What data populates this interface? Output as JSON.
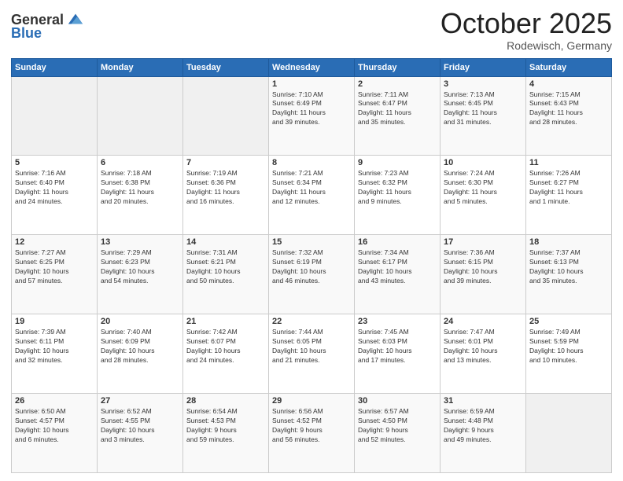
{
  "header": {
    "logo_general": "General",
    "logo_blue": "Blue",
    "month": "October 2025",
    "location": "Rodewisch, Germany"
  },
  "weekdays": [
    "Sunday",
    "Monday",
    "Tuesday",
    "Wednesday",
    "Thursday",
    "Friday",
    "Saturday"
  ],
  "weeks": [
    [
      {
        "day": "",
        "info": ""
      },
      {
        "day": "",
        "info": ""
      },
      {
        "day": "",
        "info": ""
      },
      {
        "day": "1",
        "info": "Sunrise: 7:10 AM\nSunset: 6:49 PM\nDaylight: 11 hours\nand 39 minutes."
      },
      {
        "day": "2",
        "info": "Sunrise: 7:11 AM\nSunset: 6:47 PM\nDaylight: 11 hours\nand 35 minutes."
      },
      {
        "day": "3",
        "info": "Sunrise: 7:13 AM\nSunset: 6:45 PM\nDaylight: 11 hours\nand 31 minutes."
      },
      {
        "day": "4",
        "info": "Sunrise: 7:15 AM\nSunset: 6:43 PM\nDaylight: 11 hours\nand 28 minutes."
      }
    ],
    [
      {
        "day": "5",
        "info": "Sunrise: 7:16 AM\nSunset: 6:40 PM\nDaylight: 11 hours\nand 24 minutes."
      },
      {
        "day": "6",
        "info": "Sunrise: 7:18 AM\nSunset: 6:38 PM\nDaylight: 11 hours\nand 20 minutes."
      },
      {
        "day": "7",
        "info": "Sunrise: 7:19 AM\nSunset: 6:36 PM\nDaylight: 11 hours\nand 16 minutes."
      },
      {
        "day": "8",
        "info": "Sunrise: 7:21 AM\nSunset: 6:34 PM\nDaylight: 11 hours\nand 12 minutes."
      },
      {
        "day": "9",
        "info": "Sunrise: 7:23 AM\nSunset: 6:32 PM\nDaylight: 11 hours\nand 9 minutes."
      },
      {
        "day": "10",
        "info": "Sunrise: 7:24 AM\nSunset: 6:30 PM\nDaylight: 11 hours\nand 5 minutes."
      },
      {
        "day": "11",
        "info": "Sunrise: 7:26 AM\nSunset: 6:27 PM\nDaylight: 11 hours\nand 1 minute."
      }
    ],
    [
      {
        "day": "12",
        "info": "Sunrise: 7:27 AM\nSunset: 6:25 PM\nDaylight: 10 hours\nand 57 minutes."
      },
      {
        "day": "13",
        "info": "Sunrise: 7:29 AM\nSunset: 6:23 PM\nDaylight: 10 hours\nand 54 minutes."
      },
      {
        "day": "14",
        "info": "Sunrise: 7:31 AM\nSunset: 6:21 PM\nDaylight: 10 hours\nand 50 minutes."
      },
      {
        "day": "15",
        "info": "Sunrise: 7:32 AM\nSunset: 6:19 PM\nDaylight: 10 hours\nand 46 minutes."
      },
      {
        "day": "16",
        "info": "Sunrise: 7:34 AM\nSunset: 6:17 PM\nDaylight: 10 hours\nand 43 minutes."
      },
      {
        "day": "17",
        "info": "Sunrise: 7:36 AM\nSunset: 6:15 PM\nDaylight: 10 hours\nand 39 minutes."
      },
      {
        "day": "18",
        "info": "Sunrise: 7:37 AM\nSunset: 6:13 PM\nDaylight: 10 hours\nand 35 minutes."
      }
    ],
    [
      {
        "day": "19",
        "info": "Sunrise: 7:39 AM\nSunset: 6:11 PM\nDaylight: 10 hours\nand 32 minutes."
      },
      {
        "day": "20",
        "info": "Sunrise: 7:40 AM\nSunset: 6:09 PM\nDaylight: 10 hours\nand 28 minutes."
      },
      {
        "day": "21",
        "info": "Sunrise: 7:42 AM\nSunset: 6:07 PM\nDaylight: 10 hours\nand 24 minutes."
      },
      {
        "day": "22",
        "info": "Sunrise: 7:44 AM\nSunset: 6:05 PM\nDaylight: 10 hours\nand 21 minutes."
      },
      {
        "day": "23",
        "info": "Sunrise: 7:45 AM\nSunset: 6:03 PM\nDaylight: 10 hours\nand 17 minutes."
      },
      {
        "day": "24",
        "info": "Sunrise: 7:47 AM\nSunset: 6:01 PM\nDaylight: 10 hours\nand 13 minutes."
      },
      {
        "day": "25",
        "info": "Sunrise: 7:49 AM\nSunset: 5:59 PM\nDaylight: 10 hours\nand 10 minutes."
      }
    ],
    [
      {
        "day": "26",
        "info": "Sunrise: 6:50 AM\nSunset: 4:57 PM\nDaylight: 10 hours\nand 6 minutes."
      },
      {
        "day": "27",
        "info": "Sunrise: 6:52 AM\nSunset: 4:55 PM\nDaylight: 10 hours\nand 3 minutes."
      },
      {
        "day": "28",
        "info": "Sunrise: 6:54 AM\nSunset: 4:53 PM\nDaylight: 9 hours\nand 59 minutes."
      },
      {
        "day": "29",
        "info": "Sunrise: 6:56 AM\nSunset: 4:52 PM\nDaylight: 9 hours\nand 56 minutes."
      },
      {
        "day": "30",
        "info": "Sunrise: 6:57 AM\nSunset: 4:50 PM\nDaylight: 9 hours\nand 52 minutes."
      },
      {
        "day": "31",
        "info": "Sunrise: 6:59 AM\nSunset: 4:48 PM\nDaylight: 9 hours\nand 49 minutes."
      },
      {
        "day": "",
        "info": ""
      }
    ]
  ]
}
